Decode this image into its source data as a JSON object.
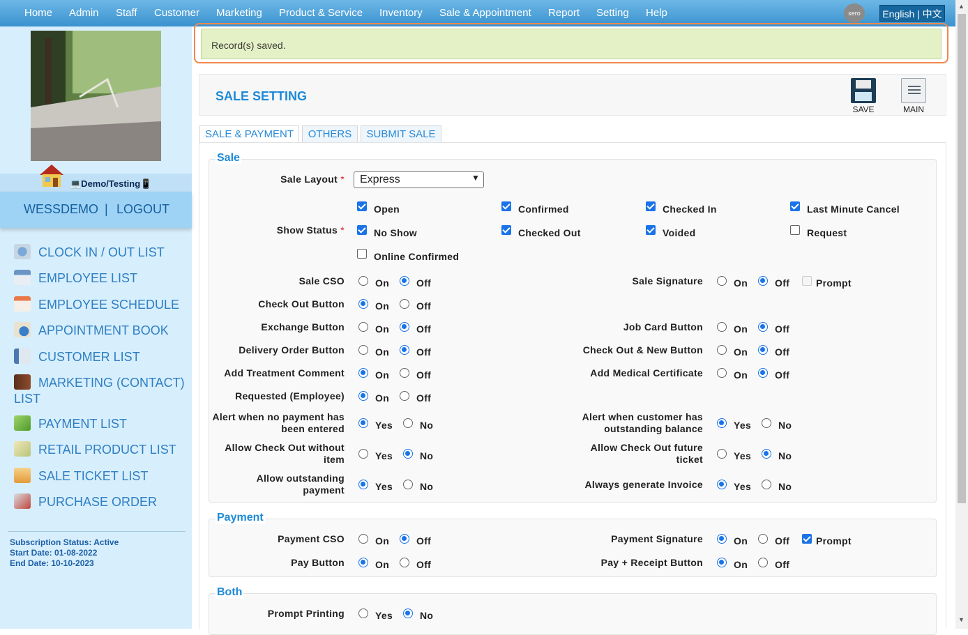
{
  "nav": {
    "items": [
      "Home",
      "Admin",
      "Staff",
      "Customer",
      "Marketing",
      "Product & Service",
      "Inventory",
      "Sale & Appointment",
      "Report",
      "Setting",
      "Help"
    ],
    "xero": "xero",
    "language": "English | 中文"
  },
  "sidebar": {
    "demo_label": "💻Demo/Testing📱",
    "user": "WESSDEMO",
    "separator": "|",
    "logout": "LOGOUT",
    "items": [
      {
        "label": "CLOCK IN / OUT LIST",
        "icon": "clock-icon"
      },
      {
        "label": "EMPLOYEE LIST",
        "icon": "employee-card-icon"
      },
      {
        "label": "EMPLOYEE SCHEDULE",
        "icon": "calendar-icon"
      },
      {
        "label": "APPOINTMENT BOOK",
        "icon": "appointment-icon"
      },
      {
        "label": "CUSTOMER LIST",
        "icon": "customer-list-icon"
      },
      {
        "label": "MARKETING (CONTACT) LIST",
        "icon": "contact-book-icon"
      },
      {
        "label": "PAYMENT LIST",
        "icon": "money-icon"
      },
      {
        "label": "RETAIL PRODUCT LIST",
        "icon": "product-box-icon"
      },
      {
        "label": "SALE TICKET LIST",
        "icon": "ticket-icon"
      },
      {
        "label": "PURCHASE ORDER",
        "icon": "purchase-order-icon"
      }
    ],
    "subscription": {
      "status": "Subscription Status: Active",
      "start": "Start Date: 01-08-2022",
      "end": "End Date: 10-10-2023"
    }
  },
  "alert": {
    "message": "Record(s) saved."
  },
  "header": {
    "title": "SALE SETTING",
    "save_label": "SAVE",
    "main_label": "MAIN"
  },
  "tabs": [
    "SALE & PAYMENT",
    "OTHERS",
    "SUBMIT SALE"
  ],
  "sections": {
    "sale": "Sale",
    "payment": "Payment",
    "both": "Both"
  },
  "options": {
    "on": "On",
    "off": "Off",
    "yes": "Yes",
    "no": "No",
    "prompt": "Prompt"
  },
  "sale": {
    "layout_label": "Sale Layout",
    "layout_value": "Express",
    "show_status_label": "Show Status",
    "statuses": [
      {
        "label": "Open",
        "checked": true
      },
      {
        "label": "Confirmed",
        "checked": true
      },
      {
        "label": "Checked In",
        "checked": true
      },
      {
        "label": "Last Minute Cancel",
        "checked": true
      },
      {
        "label": "No Show",
        "checked": true
      },
      {
        "label": "Checked Out",
        "checked": true
      },
      {
        "label": "Voided",
        "checked": true
      },
      {
        "label": "Request",
        "checked": false
      },
      {
        "label": "Online Confirmed",
        "checked": false
      }
    ],
    "settings_left": [
      {
        "label": "Sale CSO",
        "value": "Off"
      },
      {
        "label": "Check Out Button",
        "value": "On"
      },
      {
        "label": "Exchange Button",
        "value": "Off"
      },
      {
        "label": "Delivery Order Button",
        "value": "Off"
      },
      {
        "label": "Add Treatment Comment",
        "value": "On"
      },
      {
        "label": "Requested (Employee)",
        "value": "On"
      },
      {
        "label": "Alert when no payment has been entered",
        "value": "Yes"
      },
      {
        "label": "Allow Check Out without item",
        "value": "No"
      },
      {
        "label": "Allow outstanding payment",
        "value": "Yes"
      }
    ],
    "settings_right": [
      {
        "label": "Sale Signature",
        "value": "Off",
        "prompt": false
      },
      {
        "label": "Job Card Button",
        "value": "Off"
      },
      {
        "label": "Check Out & New Button",
        "value": "Off"
      },
      {
        "label": "Add Medical Certificate",
        "value": "Off"
      },
      {
        "label": "Alert when customer has outstanding balance",
        "value": "Yes"
      },
      {
        "label": "Allow Check Out future ticket",
        "value": "No"
      },
      {
        "label": "Always generate Invoice",
        "value": "Yes"
      }
    ]
  },
  "payment": {
    "settings": [
      {
        "label": "Payment CSO",
        "value": "Off"
      },
      {
        "label": "Pay Button",
        "value": "On"
      },
      {
        "label": "Payment Signature",
        "value": "On",
        "prompt": true
      },
      {
        "label": "Pay + Receipt Button",
        "value": "On"
      }
    ]
  },
  "both": {
    "settings": [
      {
        "label": "Prompt Printing",
        "value": "No"
      }
    ]
  },
  "colors": {
    "accent": "#1d8ad8",
    "nav": "#3a92cf",
    "sidebar": "#d7eefc",
    "alert_border": "#f0884a",
    "alert_bg": "#e4f0c5"
  }
}
